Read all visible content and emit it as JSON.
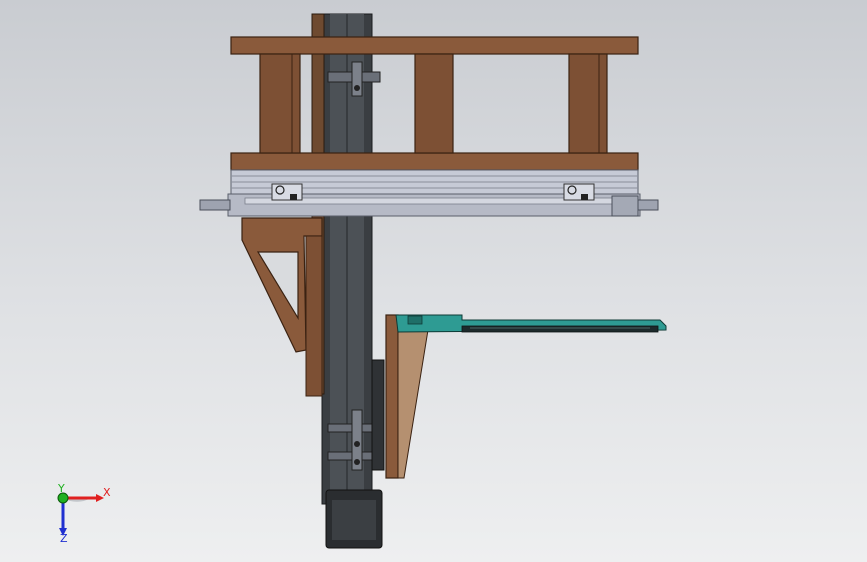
{
  "triad": {
    "x_label": "X",
    "y_label": "Y",
    "z_label": "Z",
    "x_color": "#e02020",
    "y_color": "#20b020",
    "z_color": "#2030d0"
  },
  "colors": {
    "background_top": "#c9ccd1",
    "background_bottom": "#eeeff0",
    "wood": "#8a5a3b",
    "wood_dark": "#5e3a22",
    "steel": "#c8ccd8",
    "steel_dark": "#7a7f8c",
    "rail": "#3f4347",
    "teal": "#2e9b93"
  }
}
